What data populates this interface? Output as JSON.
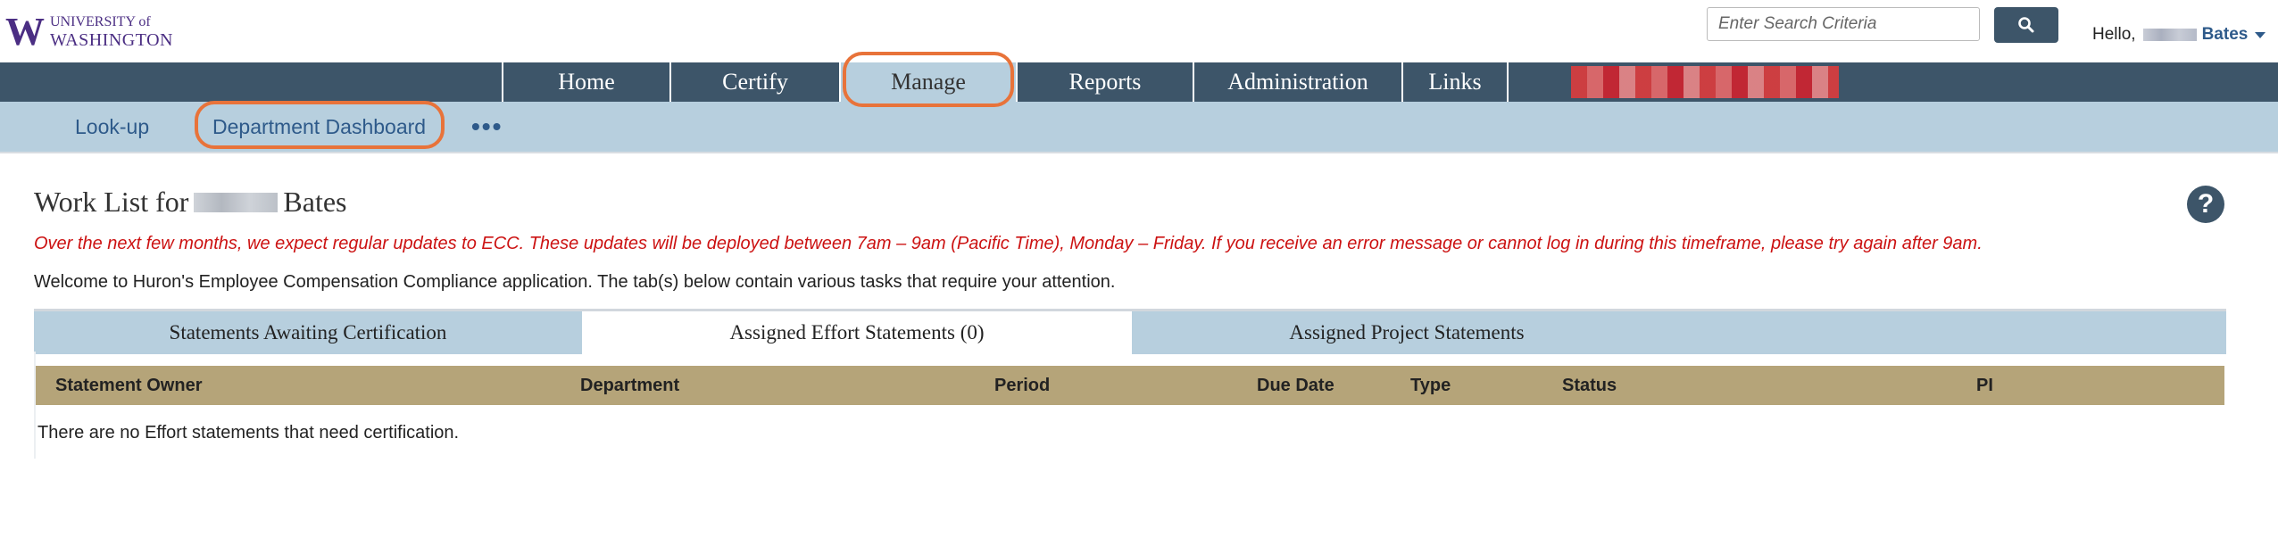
{
  "header": {
    "logo": {
      "mark": "W",
      "line1": "UNIVERSITY of",
      "line2": "WASHINGTON"
    },
    "search": {
      "placeholder": "Enter Search Criteria",
      "button_icon": "search-icon"
    },
    "greeting": {
      "hello": "Hello,",
      "last_name": "Bates"
    }
  },
  "nav": {
    "items": [
      {
        "label": "Home"
      },
      {
        "label": "Certify"
      },
      {
        "label": "Manage",
        "active": true
      },
      {
        "label": "Reports"
      },
      {
        "label": "Administration"
      },
      {
        "label": "Links"
      }
    ]
  },
  "subnav": {
    "items": [
      {
        "label": "Look-up"
      },
      {
        "label": "Department Dashboard"
      }
    ],
    "more": "•••"
  },
  "page": {
    "title_prefix": "Work List for",
    "title_last": "Bates",
    "help_icon": "?",
    "notice": "Over the next few months, we expect regular updates to ECC. These updates will be deployed between 7am – 9am (Pacific Time), Monday – Friday. If you receive an error message or cannot log in during this timeframe, please try again after 9am.",
    "welcome": "Welcome to Huron's Employee Compensation Compliance application. The tab(s) below contain various tasks that require your attention."
  },
  "tabs": [
    {
      "label": "Statements Awaiting Certification"
    },
    {
      "label": "Assigned Effort Statements (0)",
      "active": true
    },
    {
      "label": "Assigned Project Statements"
    }
  ],
  "table": {
    "columns": [
      "Statement Owner",
      "Department",
      "Period",
      "Due Date",
      "Type",
      "Status",
      "PI"
    ],
    "empty_message": "There are no Effort statements that need certification."
  },
  "colors": {
    "nav_bg": "#3d5569",
    "subnav_bg": "#b7cfde",
    "table_header_bg": "#b5a479",
    "notice_text": "#cc1212",
    "brand_purple": "#4b2e83",
    "annotation": "#e8733a"
  }
}
